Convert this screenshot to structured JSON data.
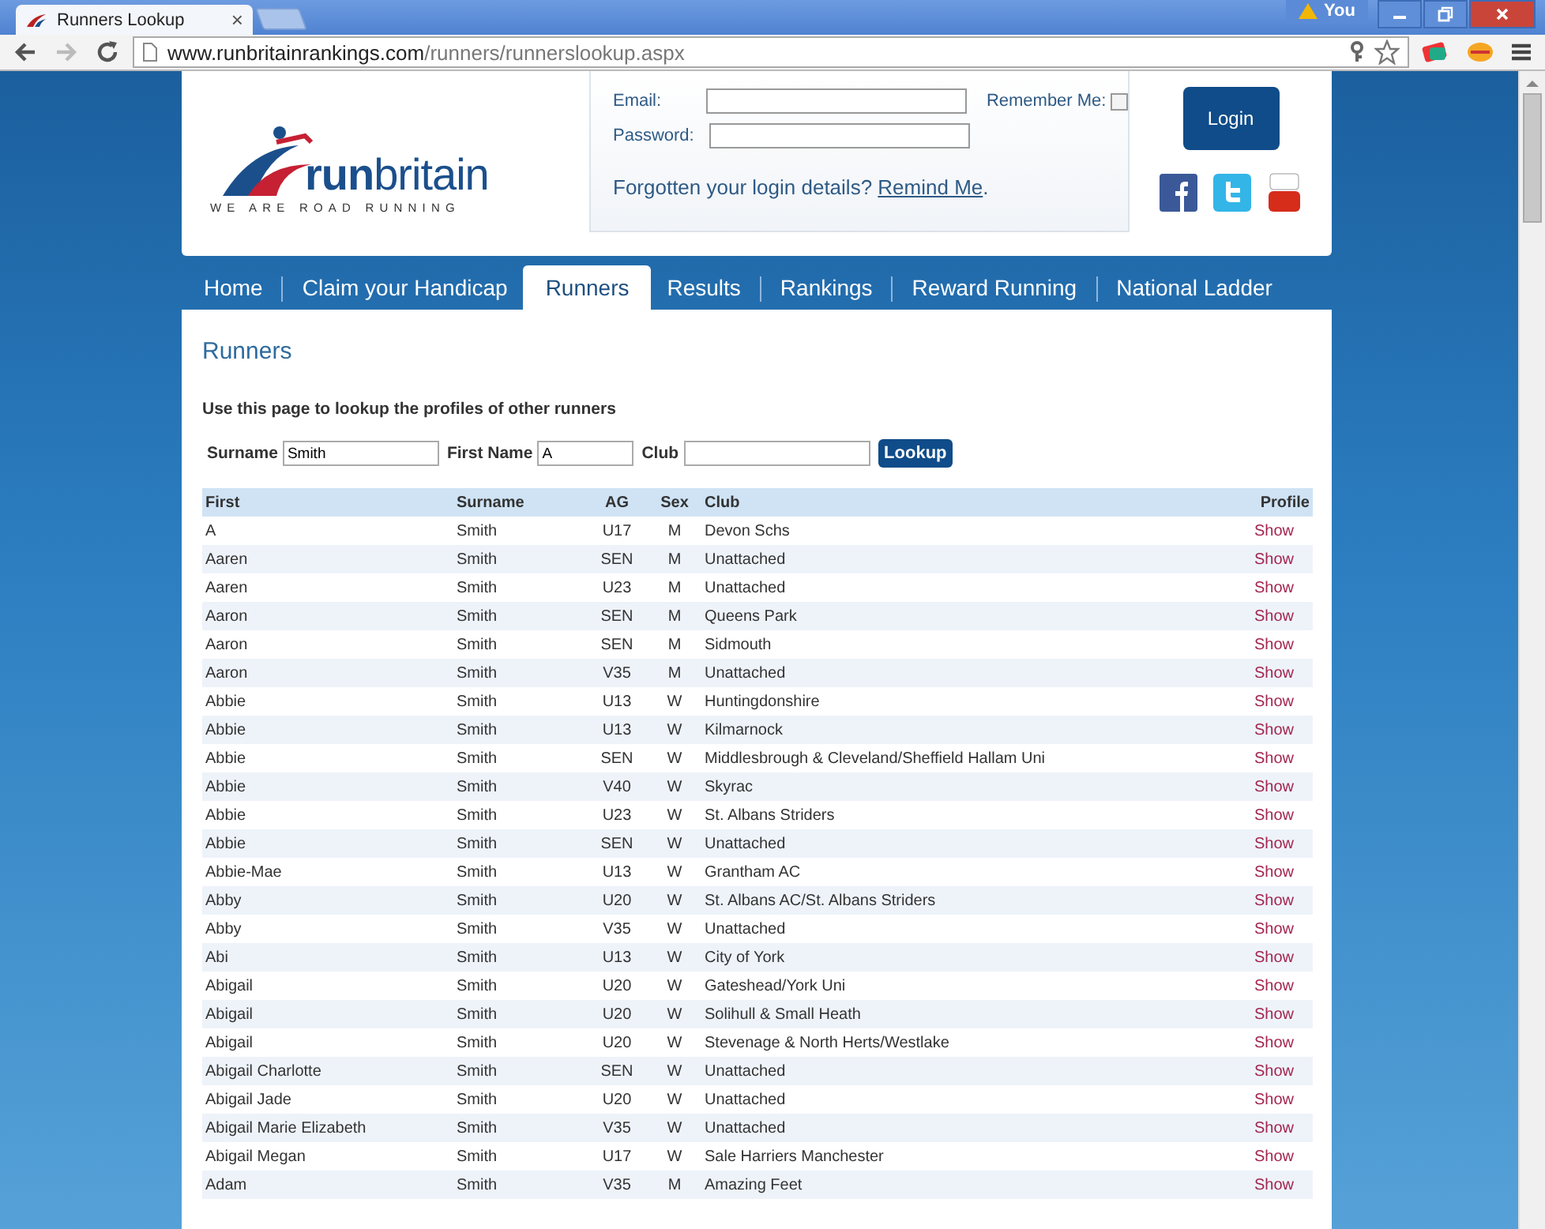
{
  "browser": {
    "tab_title": "Runners Lookup",
    "tab_close": "×",
    "profile": "You",
    "url_host": "www.runbritainrankings.com",
    "url_path": "/runners/runnerslookup.aspx"
  },
  "header": {
    "logo_text": "**run**britain",
    "tagline": "WE ARE ROAD RUNNING",
    "email_label": "Email:",
    "password_label": "Password:",
    "remember_label": "Remember Me:",
    "remember_checked": false,
    "login_button": "Login",
    "forgot_text": "Forgotten your login details?",
    "remind_link": "Remind Me",
    "forgot_end": "."
  },
  "nav": [
    {
      "label": "Home",
      "selected": false
    },
    {
      "label": "Claim your Handicap",
      "selected": false
    },
    {
      "label": "Runners",
      "selected": true
    },
    {
      "label": "Results",
      "selected": false
    },
    {
      "label": "Rankings",
      "selected": false
    },
    {
      "label": "Reward Running",
      "selected": false
    },
    {
      "label": "National Ladder",
      "selected": false
    }
  ],
  "page": {
    "title": "Runners",
    "intro": "Use this page to lookup the profiles of other runners"
  },
  "search": {
    "surname_label": "Surname",
    "surname_value": "Smith",
    "first_label": "First Name",
    "first_value": "A",
    "club_label": "Club",
    "button": "Lookup"
  },
  "table": {
    "columns": [
      "First",
      "Surname",
      "AG",
      "Sex",
      "Club",
      "Profile"
    ],
    "rows": [
      {
        "first": "A",
        "surname": "Smith",
        "ag": "U17",
        "sex": "M",
        "club": "Devon Schs",
        "profile": "Show"
      },
      {
        "first": "Aaren",
        "surname": "Smith",
        "ag": "SEN",
        "sex": "M",
        "club": "Unattached",
        "profile": "Show"
      },
      {
        "first": "Aaren",
        "surname": "Smith",
        "ag": "U23",
        "sex": "M",
        "club": "Unattached",
        "profile": "Show"
      },
      {
        "first": "Aaron",
        "surname": "Smith",
        "ag": "SEN",
        "sex": "M",
        "club": "Queens Park",
        "profile": "Show"
      },
      {
        "first": "Aaron",
        "surname": "Smith",
        "ag": "SEN",
        "sex": "M",
        "club": "Sidmouth",
        "profile": "Show"
      },
      {
        "first": "Aaron",
        "surname": "Smith",
        "ag": "V35",
        "sex": "M",
        "club": "Unattached",
        "profile": "Show"
      },
      {
        "first": "Abbie",
        "surname": "Smith",
        "ag": "U13",
        "sex": "W",
        "club": "Huntingdonshire",
        "profile": "Show"
      },
      {
        "first": "Abbie",
        "surname": "Smith",
        "ag": "U13",
        "sex": "W",
        "club": "Kilmarnock",
        "profile": "Show"
      },
      {
        "first": "Abbie",
        "surname": "Smith",
        "ag": "SEN",
        "sex": "W",
        "club": "Middlesbrough & Cleveland/Sheffield Hallam Uni",
        "profile": "Show"
      },
      {
        "first": "Abbie",
        "surname": "Smith",
        "ag": "V40",
        "sex": "W",
        "club": "Skyrac",
        "profile": "Show"
      },
      {
        "first": "Abbie",
        "surname": "Smith",
        "ag": "U23",
        "sex": "W",
        "club": "St. Albans Striders",
        "profile": "Show"
      },
      {
        "first": "Abbie",
        "surname": "Smith",
        "ag": "SEN",
        "sex": "W",
        "club": "Unattached",
        "profile": "Show"
      },
      {
        "first": "Abbie-Mae",
        "surname": "Smith",
        "ag": "U13",
        "sex": "W",
        "club": "Grantham AC",
        "profile": "Show"
      },
      {
        "first": "Abby",
        "surname": "Smith",
        "ag": "U20",
        "sex": "W",
        "club": "St. Albans AC/St. Albans Striders",
        "profile": "Show"
      },
      {
        "first": "Abby",
        "surname": "Smith",
        "ag": "V35",
        "sex": "W",
        "club": "Unattached",
        "profile": "Show"
      },
      {
        "first": "Abi",
        "surname": "Smith",
        "ag": "U13",
        "sex": "W",
        "club": "City of York",
        "profile": "Show"
      },
      {
        "first": "Abigail",
        "surname": "Smith",
        "ag": "U20",
        "sex": "W",
        "club": "Gateshead/York Uni",
        "profile": "Show"
      },
      {
        "first": "Abigail",
        "surname": "Smith",
        "ag": "U20",
        "sex": "W",
        "club": "Solihull & Small Heath",
        "profile": "Show"
      },
      {
        "first": "Abigail",
        "surname": "Smith",
        "ag": "U20",
        "sex": "W",
        "club": "Stevenage & North Herts/Westlake",
        "profile": "Show"
      },
      {
        "first": "Abigail Charlotte",
        "surname": "Smith",
        "ag": "SEN",
        "sex": "W",
        "club": "Unattached",
        "profile": "Show"
      },
      {
        "first": "Abigail Jade",
        "surname": "Smith",
        "ag": "U20",
        "sex": "W",
        "club": "Unattached",
        "profile": "Show"
      },
      {
        "first": "Abigail Marie Elizabeth",
        "surname": "Smith",
        "ag": "V35",
        "sex": "W",
        "club": "Unattached",
        "profile": "Show"
      },
      {
        "first": "Abigail Megan",
        "surname": "Smith",
        "ag": "U17",
        "sex": "W",
        "club": "Sale Harriers Manchester",
        "profile": "Show"
      },
      {
        "first": "Adam",
        "surname": "Smith",
        "ag": "V35",
        "sex": "M",
        "club": "Amazing Feet",
        "profile": "Show"
      }
    ]
  }
}
